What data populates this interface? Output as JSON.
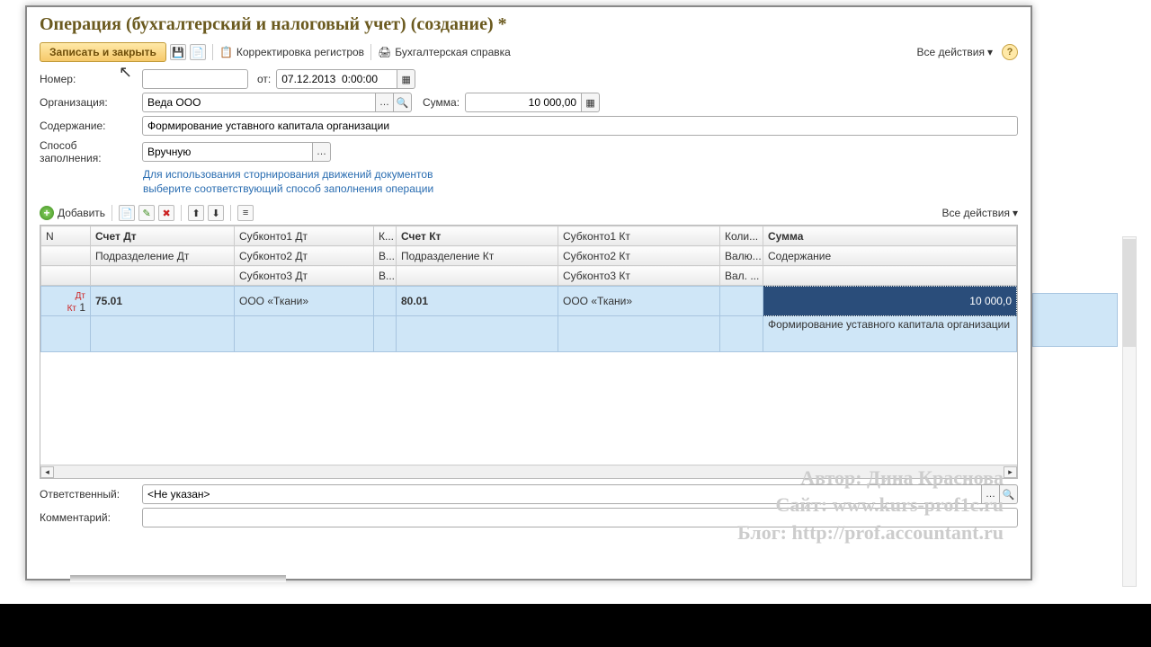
{
  "window": {
    "title": "Операция (бухгалтерский и налоговый учет) (создание) *"
  },
  "toolbar": {
    "save_close": "Записать и закрыть",
    "reg_correct": "Корректировка регистров",
    "acc_ref": "Бухгалтерская справка",
    "all_actions": "Все действия"
  },
  "fields": {
    "number_label": "Номер:",
    "number_value": "",
    "from_label": "от:",
    "date_value": "07.12.2013  0:00:00",
    "org_label": "Организация:",
    "org_value": "Веда ООО",
    "sum_label": "Сумма:",
    "sum_value": "10 000,00",
    "content_label": "Содержание:",
    "content_value": "Формирование уставного капитала организации",
    "method_label": "Способ заполнения:",
    "method_value": "Вручную",
    "hint1": "Для использования сторнирования движений документов",
    "hint2": "выберите соответствующий способ заполнения операции"
  },
  "grid_toolbar": {
    "add": "Добавить",
    "all_actions": "Все действия"
  },
  "grid": {
    "headers": {
      "n": "N",
      "acc_dt": "Счет Дт",
      "dept_dt": "Подразделение Дт",
      "sub1_dt": "Субконто1 Дт",
      "sub2_dt": "Субконто2 Дт",
      "sub3_dt": "Субконто3 Дт",
      "k": "К...",
      "v": "В...",
      "v2": "В...",
      "acc_kt": "Счет Кт",
      "dept_kt": "Подразделение Кт",
      "sub1_kt": "Субконто1 Кт",
      "sub2_kt": "Субконто2 Кт",
      "sub3_kt": "Субконто3 Кт",
      "qty": "Коли...",
      "curr": "Валю...",
      "val": "Вал. ...",
      "sum": "Сумма",
      "content": "Содержание"
    },
    "row": {
      "n": "1",
      "acc_dt": "75.01",
      "sub1_dt": "ООО «Ткани»",
      "acc_kt": "80.01",
      "sub1_kt": "ООО «Ткани»",
      "sum": "10 000,0",
      "content": "Формирование уставного капитала организации"
    }
  },
  "bottom": {
    "resp_label": "Ответственный:",
    "resp_value": "<Не указан>",
    "comment_label": "Комментарий:",
    "comment_value": ""
  },
  "watermark": {
    "l1": "Автор: Дина Краснова",
    "l2": "Сайт: www.kurs-prof1c.ru",
    "l3": "Блог: http://prof.accountant.ru"
  }
}
